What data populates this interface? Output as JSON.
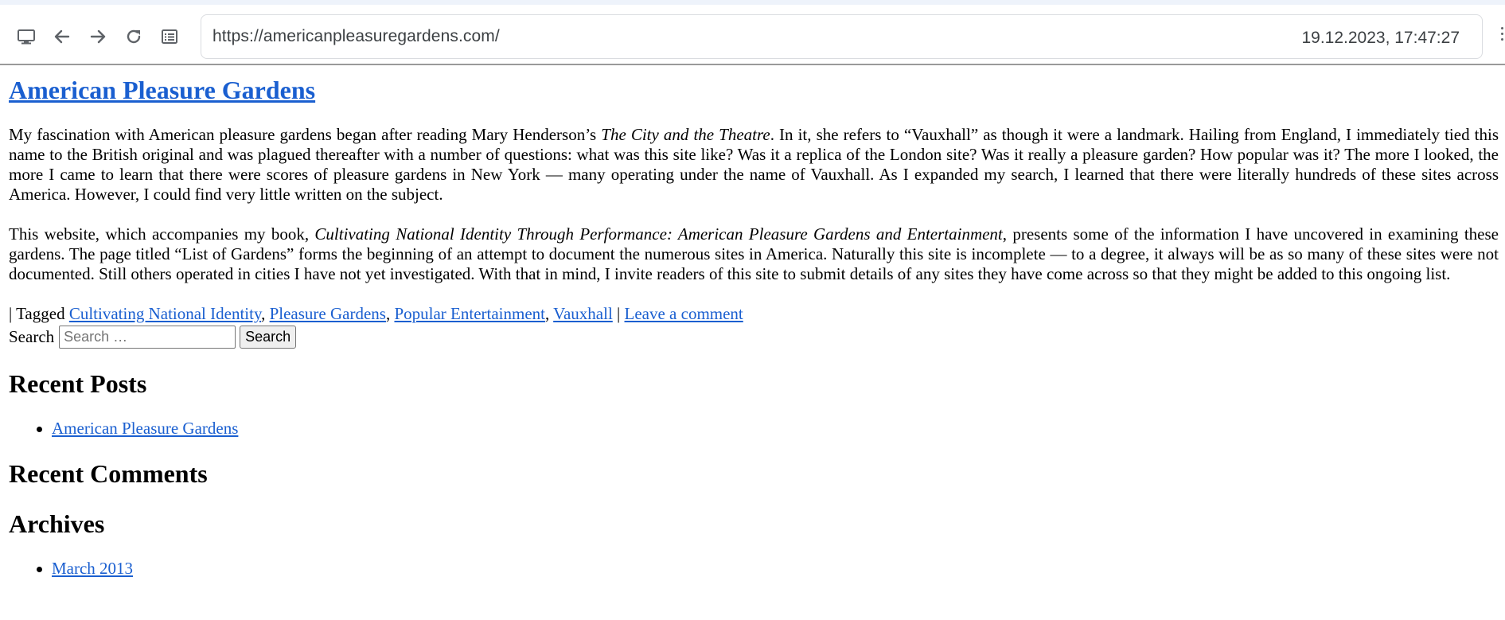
{
  "browser": {
    "url": "https://americanpleasuregardens.com/",
    "datetime": "19.12.2023, 17:47:27",
    "icons": [
      "monitor-icon",
      "back-arrow-icon",
      "forward-arrow-icon",
      "reload-icon",
      "reader-mode-icon",
      "menu-dots-icon"
    ]
  },
  "site": {
    "title": "American Pleasure Gardens"
  },
  "post": {
    "p1_a": "My fascination with American pleasure gardens began after reading Mary Henderson’s ",
    "p1_italic": "The City and the Theatre",
    "p1_b": ". In it, she refers to “Vauxhall” as though it were a landmark. Hailing from England, I immediately tied this name to the British original and was plagued thereafter with a number of questions: what was this site like? Was it a replica of the London site? Was it really a pleasure garden? How popular was it? The more I looked, the more I came to learn that there were scores of pleasure gardens in New York — many operating under the name of Vauxhall. As I expanded my search, I learned that there were literally hundreds of these sites across America. However, I could find very little written on the subject.",
    "p2_a": "This website, which accompanies my book, ",
    "p2_italic": "Cultivating National Identity Through Performance: American Pleasure Gardens and Entertainment",
    "p2_b": ", presents some of the information I have uncovered in examining these gardens. The page titled “List of Gardens” forms the beginning of an attempt to document the numerous sites in America. Naturally this site is incomplete — to a degree, it always will be as so many of these sites were not documented. Still others operated in cities I have not yet investigated. With that in mind, I invite readers of this site to submit details of any sites they have come across so that they might be added to this ongoing list."
  },
  "meta": {
    "tagged_prefix": "| Tagged ",
    "tags": [
      "Cultivating National Identity",
      "Pleasure Gardens",
      "Popular Entertainment",
      "Vauxhall"
    ],
    "separator": ", ",
    "pipe": " | ",
    "comment_link": "Leave a comment"
  },
  "search": {
    "label": "Search",
    "placeholder": "Search …",
    "button": "Search"
  },
  "widgets": {
    "recent_posts_title": "Recent Posts",
    "recent_posts": [
      "American Pleasure Gardens"
    ],
    "recent_comments_title": "Recent Comments",
    "archives_title": "Archives",
    "archives": [
      "March 2013"
    ]
  }
}
